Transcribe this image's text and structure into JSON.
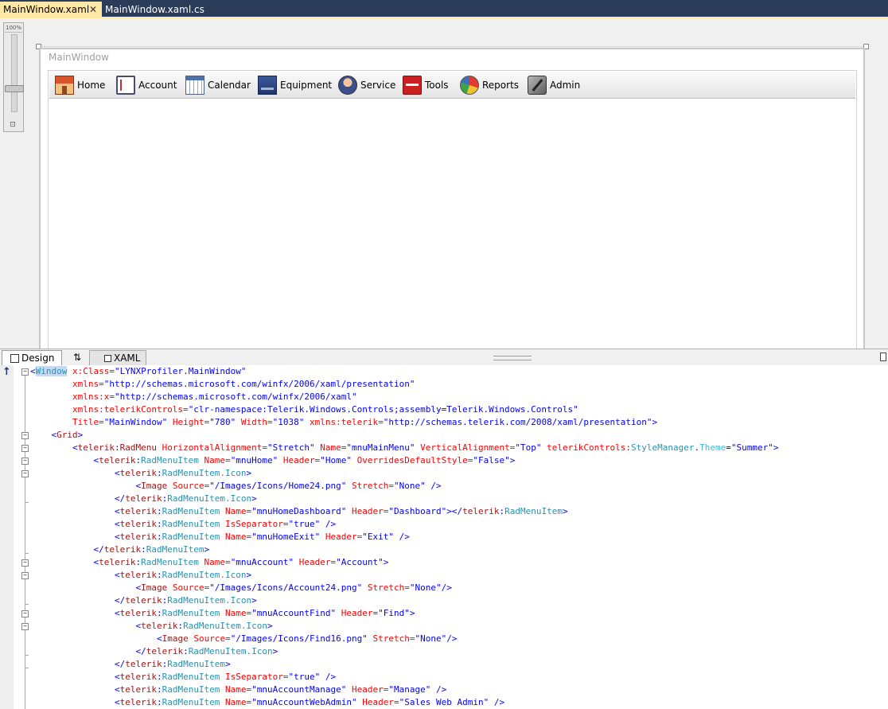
{
  "doc_tabs": [
    {
      "label": "MainWindow.xaml",
      "active": true,
      "close": "✕"
    },
    {
      "label": "MainWindow.xaml.cs",
      "active": false
    }
  ],
  "zoom": {
    "label": "100%"
  },
  "designer": {
    "window_title": "MainWindow",
    "menu_items": [
      {
        "label": "Home",
        "icon": "home-icon"
      },
      {
        "label": "Account",
        "icon": "account-icon"
      },
      {
        "label": "Calendar",
        "icon": "calendar-icon"
      },
      {
        "label": "Equipment",
        "icon": "equipment-icon"
      },
      {
        "label": "Service",
        "icon": "service-icon"
      },
      {
        "label": "Tools",
        "icon": "tools-icon"
      },
      {
        "label": "Reports",
        "icon": "reports-icon"
      },
      {
        "label": "Admin",
        "icon": "admin-icon"
      }
    ]
  },
  "view_tabs": {
    "design": "Design",
    "swap": "⇅",
    "xaml": "XAML"
  },
  "code": {
    "l1": {
      "t0": "<",
      "t1": "Window",
      "t2": " x:Class=",
      "t3": "\"LYNXProfiler.MainWindow\""
    },
    "l2": {
      "t0": "        xmlns=",
      "t1": "\"http://schemas.microsoft.com/winfx/2006/xaml/presentation\""
    },
    "l3": {
      "t0": "        xmlns:x=",
      "t1": "\"http://schemas.microsoft.com/winfx/2006/xaml\""
    },
    "l4": {
      "t0": "        xmlns:telerikControls=",
      "t1": "\"clr-namespace:Telerik.Windows.Controls;assembly=Telerik.Windows.Controls\""
    },
    "l5": {
      "t0": "        Title=",
      "t1": "\"MainWindow\"",
      "t2": " Height=",
      "t3": "\"780\"",
      "t4": " Width=",
      "t5": "\"1038\"",
      "t6": " xmlns:telerik=",
      "t7": "\"http://schemas.telerik.com/2008/xaml/presentation\"",
      "t8": ">"
    },
    "l6": {
      "t0": "    <",
      "t1": "Grid",
      "t2": ">"
    },
    "l7": {
      "t0": "        <",
      "t1": "telerik",
      "t2": ":",
      "t3": "RadMenu",
      "t4": " HorizontalAlignment=",
      "t5": "\"Stretch\"",
      "t6": " Name=",
      "t7": "\"mnuMainMenu\"",
      "t8": " VerticalAlignment=",
      "t9": "\"Top\"",
      "t10": " telerikControls:",
      "t11": "StyleManager",
      "t12": ".",
      "t13": "Theme",
      "t14": "=",
      "t15": "\"Summer\"",
      "t16": ">"
    },
    "l8": {
      "t0": "            <",
      "t1": "telerik",
      "t2": ":",
      "t3": "RadMenuItem",
      "t4": " Name=",
      "t5": "\"mnuHome\"",
      "t6": " Header=",
      "t7": "\"Home\"",
      "t8": " OverridesDefaultStyle=",
      "t9": "\"False\"",
      "t10": ">"
    },
    "l9": {
      "t0": "                <",
      "t1": "telerik",
      "t2": ":",
      "t3": "RadMenuItem.Icon",
      "t4": ">"
    },
    "l10": {
      "t0": "                    <",
      "t1": "Image",
      "t2": " Source=",
      "t3": "\"/Images/Icons/Home24.png\"",
      "t4": " Stretch=",
      "t5": "\"None\"",
      "t6": " />"
    },
    "l11": {
      "t0": "                </",
      "t1": "telerik",
      "t2": ":",
      "t3": "RadMenuItem.Icon",
      "t4": ">"
    },
    "l12": {
      "t0": "                <",
      "t1": "telerik",
      "t2": ":",
      "t3": "RadMenuItem",
      "t4": " Name=",
      "t5": "\"mnuHomeDashboard\"",
      "t6": " Header=",
      "t7": "\"Dashboard\"",
      "t8": "></",
      "t9": "telerik",
      "t10": ":",
      "t11": "RadMenuItem",
      "t12": ">"
    },
    "l13": {
      "t0": "                <",
      "t1": "telerik",
      "t2": ":",
      "t3": "RadMenuItem",
      "t4": " IsSeparator=",
      "t5": "\"true\"",
      "t6": " />"
    },
    "l14": {
      "t0": "                <",
      "t1": "telerik",
      "t2": ":",
      "t3": "RadMenuItem",
      "t4": " Name=",
      "t5": "\"mnuHomeExit\"",
      "t6": " Header=",
      "t7": "\"Exit\"",
      "t8": " />"
    },
    "l15": {
      "t0": "            </",
      "t1": "telerik",
      "t2": ":",
      "t3": "RadMenuItem",
      "t4": ">"
    },
    "l16": {
      "t0": "            <",
      "t1": "telerik",
      "t2": ":",
      "t3": "RadMenuItem",
      "t4": " Name=",
      "t5": "\"mnuAccount\"",
      "t6": " Header=",
      "t7": "\"Account\"",
      "t8": ">"
    },
    "l17": {
      "t0": "                <",
      "t1": "telerik",
      "t2": ":",
      "t3": "RadMenuItem.Icon",
      "t4": ">"
    },
    "l18": {
      "t0": "                    <",
      "t1": "Image",
      "t2": " Source=",
      "t3": "\"/Images/Icons/Account24.png\"",
      "t4": " Stretch=",
      "t5": "\"None\"",
      "t6": "/>"
    },
    "l19": {
      "t0": "                </",
      "t1": "telerik",
      "t2": ":",
      "t3": "RadMenuItem.Icon",
      "t4": ">"
    },
    "l20": {
      "t0": "                <",
      "t1": "telerik",
      "t2": ":",
      "t3": "RadMenuItem",
      "t4": " Name=",
      "t5": "\"mnuAccountFind\"",
      "t6": " Header=",
      "t7": "\"Find\"",
      "t8": ">"
    },
    "l21": {
      "t0": "                    <",
      "t1": "telerik",
      "t2": ":",
      "t3": "RadMenuItem.Icon",
      "t4": ">"
    },
    "l22": {
      "t0": "                        <",
      "t1": "Image",
      "t2": " Source=",
      "t3": "\"/Images/Icons/Find16.png\"",
      "t4": " Stretch=",
      "t5": "\"None\"",
      "t6": "/>"
    },
    "l23": {
      "t0": "                    </",
      "t1": "telerik",
      "t2": ":",
      "t3": "RadMenuItem.Icon",
      "t4": ">"
    },
    "l24": {
      "t0": "                </",
      "t1": "telerik",
      "t2": ":",
      "t3": "RadMenuItem",
      "t4": ">"
    },
    "l25": {
      "t0": "                <",
      "t1": "telerik",
      "t2": ":",
      "t3": "RadMenuItem",
      "t4": " IsSeparator=",
      "t5": "\"true\"",
      "t6": " />"
    },
    "l26": {
      "t0": "                <",
      "t1": "telerik",
      "t2": ":",
      "t3": "RadMenuItem",
      "t4": " Name=",
      "t5": "\"mnuAccountManage\"",
      "t6": " Header=",
      "t7": "\"Manage\"",
      "t8": " />"
    },
    "l27": {
      "t0": "                <",
      "t1": "telerik",
      "t2": ":",
      "t3": "RadMenuItem",
      "t4": " Name=",
      "t5": "\"mnuAccountWebAdmin\"",
      "t6": " Header=",
      "t7": "\"Sales Web Admin\"",
      "t8": " />"
    }
  },
  "colors": {
    "tab_active": "#ffe8a6",
    "tabbar": "#2b3c59",
    "xml_tag": "#a31515",
    "xml_attr": "#ff0000",
    "xml_value": "#0000ff",
    "xml_type": "#2b91af"
  }
}
